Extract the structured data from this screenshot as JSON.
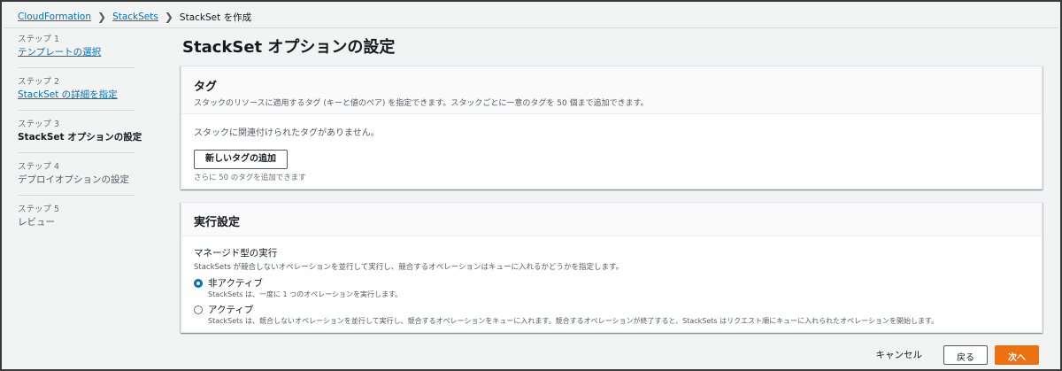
{
  "breadcrumb": {
    "items": [
      "CloudFormation",
      "StackSets"
    ],
    "current": "StackSet を作成"
  },
  "steps": [
    {
      "number": "ステップ 1",
      "title": "テンプレートの選択",
      "state": "link"
    },
    {
      "number": "ステップ 2",
      "title": "StackSet の詳細を指定",
      "state": "link"
    },
    {
      "number": "ステップ 3",
      "title": "StackSet オプションの設定",
      "state": "current"
    },
    {
      "number": "ステップ 4",
      "title": "デプロイオプションの設定",
      "state": "disabled"
    },
    {
      "number": "ステップ 5",
      "title": "レビュー",
      "state": "disabled"
    }
  ],
  "page_title": "StackSet オプションの設定",
  "tags": {
    "title": "タグ",
    "description": "スタックのリソースに適用するタグ (キーと値のペア) を指定できます。スタックごとに一意のタグを 50 個まで追加できます。",
    "empty_text": "スタックに関連付けられたタグがありません。",
    "add_button": "新しいタグの追加",
    "hint": "さらに 50 のタグを追加できます"
  },
  "execution": {
    "title": "実行設定",
    "field_label": "マネージド型の実行",
    "field_desc": "StackSets が競合しないオペレーションを並行して実行し、競合するオペレーションはキューに入れるかどうかを指定します。",
    "options": [
      {
        "label": "非アクティブ",
        "desc": "StackSets は、一度に 1 つのオペレーションを実行します。",
        "checked": true
      },
      {
        "label": "アクティブ",
        "desc": "StackSets は、競合しないオペレーションを並行して実行し、競合するオペレーションをキューに入れます。競合するオペレーションが終了すると、StackSets はリクエスト順にキューに入れられたオペレーションを開始します。",
        "checked": false
      }
    ]
  },
  "footer": {
    "cancel": "キャンセル",
    "back": "戻る",
    "next": "次へ"
  },
  "colors": {
    "link": "#0073bb",
    "primary": "#ec7211",
    "background": "#f2f3f3"
  }
}
